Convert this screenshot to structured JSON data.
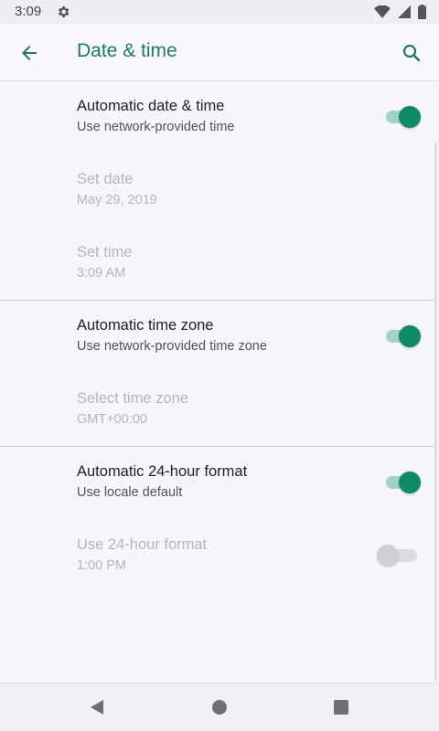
{
  "status_bar": {
    "time": "3:09",
    "icons": [
      "gear-icon",
      "wifi-icon",
      "signal-icon",
      "battery-icon"
    ]
  },
  "app_bar": {
    "title": "Date & time",
    "back_icon": "arrow-back-icon",
    "search_icon": "search-icon"
  },
  "colors": {
    "accent": "#1f7a64",
    "toggle_on_thumb": "#0d8a66",
    "toggle_on_track": "#9fd5c5",
    "disabled_text": "#b6b5bb"
  },
  "settings": [
    {
      "title": "Automatic date & time",
      "subtitle": "Use network-provided time",
      "enabled": true,
      "toggle": true
    },
    {
      "title": "Set date",
      "subtitle": "May 29, 2019",
      "enabled": false
    },
    {
      "title": "Set time",
      "subtitle": "3:09 AM",
      "enabled": false
    },
    {
      "title": "Automatic time zone",
      "subtitle": "Use network-provided time zone",
      "enabled": true,
      "toggle": true
    },
    {
      "title": "Select time zone",
      "subtitle": "GMT+00:00",
      "enabled": false
    },
    {
      "title": "Automatic 24-hour format",
      "subtitle": "Use locale default",
      "enabled": true,
      "toggle": true
    },
    {
      "title": "Use 24-hour format",
      "subtitle": "1:00 PM",
      "enabled": false,
      "toggle": false
    }
  ],
  "nav_bar": {
    "icons": [
      "back-triangle-icon",
      "home-circle-icon",
      "recents-square-icon"
    ]
  }
}
